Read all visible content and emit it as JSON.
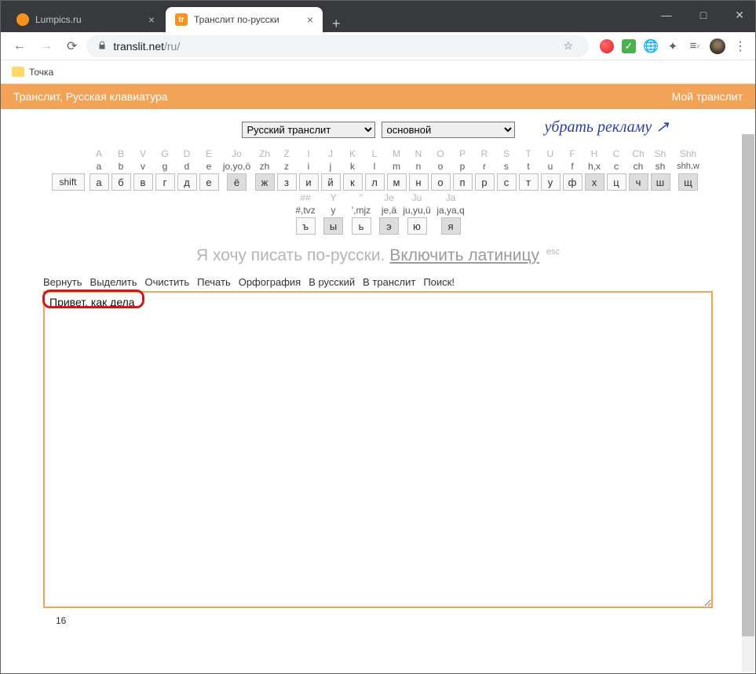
{
  "browser": {
    "tabs": [
      {
        "title": "Lumpics.ru",
        "active": false
      },
      {
        "title": "Транслит по-русски",
        "active": true
      }
    ],
    "url_host": "translit.net",
    "url_path": "/ru/",
    "bookmark": "Точка"
  },
  "header": {
    "left": "Транслит, Русская клавиатура",
    "right": "Мой транслит"
  },
  "selects": {
    "language": "Русский транслит",
    "mode": "основной"
  },
  "remove_ads": "убрать рекламу",
  "keyboard": {
    "row1": [
      {
        "top": "A",
        "mid": "a",
        "key": "а"
      },
      {
        "top": "B",
        "mid": "b",
        "key": "б"
      },
      {
        "top": "V",
        "mid": "v",
        "key": "в"
      },
      {
        "top": "G",
        "mid": "g",
        "key": "г"
      },
      {
        "top": "D",
        "mid": "d",
        "key": "д"
      },
      {
        "top": "E",
        "mid": "e",
        "key": "е"
      },
      {
        "top": "Jo",
        "mid": "jo,yo,ö",
        "key": "ё",
        "hl": true,
        "wide": true
      },
      {
        "top": "Zh",
        "mid": "zh",
        "key": "ж",
        "hl": true
      },
      {
        "top": "Z",
        "mid": "z",
        "key": "з"
      },
      {
        "top": "I",
        "mid": "i",
        "key": "и"
      },
      {
        "top": "J",
        "mid": "j",
        "key": "й"
      },
      {
        "top": "K",
        "mid": "k",
        "key": "к"
      },
      {
        "top": "L",
        "mid": "l",
        "key": "л"
      },
      {
        "top": "M",
        "mid": "m",
        "key": "м"
      },
      {
        "top": "N",
        "mid": "n",
        "key": "н"
      },
      {
        "top": "O",
        "mid": "o",
        "key": "о"
      },
      {
        "top": "P",
        "mid": "p",
        "key": "п"
      },
      {
        "top": "R",
        "mid": "r",
        "key": "р"
      },
      {
        "top": "S",
        "mid": "s",
        "key": "с"
      },
      {
        "top": "T",
        "mid": "t",
        "key": "т"
      },
      {
        "top": "U",
        "mid": "u",
        "key": "у"
      },
      {
        "top": "F",
        "mid": "f",
        "key": "ф"
      },
      {
        "top": "H",
        "mid": "h,x",
        "key": "х",
        "hl": true
      },
      {
        "top": "C",
        "mid": "c",
        "key": "ц"
      },
      {
        "top": "Ch",
        "mid": "ch",
        "key": "ч",
        "hl": true
      },
      {
        "top": "Sh",
        "mid": "sh",
        "key": "ш",
        "hl": true
      },
      {
        "top": "Shh",
        "mid": "shh,w",
        "key": "щ",
        "hl": true,
        "wide": true
      }
    ],
    "row2": [
      {
        "top": "##",
        "mid": "#,tvz",
        "key": "ъ",
        "wide": true
      },
      {
        "top": "Y",
        "mid": "y",
        "key": "ы",
        "hl": true
      },
      {
        "top": "''",
        "mid": "',mjz",
        "key": "ь",
        "wide": true
      },
      {
        "top": "Je",
        "mid": "je,ä",
        "key": "э",
        "hl": true
      },
      {
        "top": "Ju",
        "mid": "ju,yu,ü",
        "key": "ю",
        "wide": true
      },
      {
        "top": "Ja",
        "mid": "ja,ya,q",
        "key": "я",
        "hl": true,
        "wide": true
      }
    ],
    "shift_label": "shift"
  },
  "tagline": {
    "text": "Я хочу писать по-русски. ",
    "link": "Включить латиницу",
    "esc": "esc"
  },
  "actions": [
    "Вернуть",
    "Выделить",
    "Очистить",
    "Печать",
    "Орфография",
    "В русский",
    "В транслит",
    "Поиск!"
  ],
  "editor_text": "Привет, как дела",
  "counter": "16"
}
